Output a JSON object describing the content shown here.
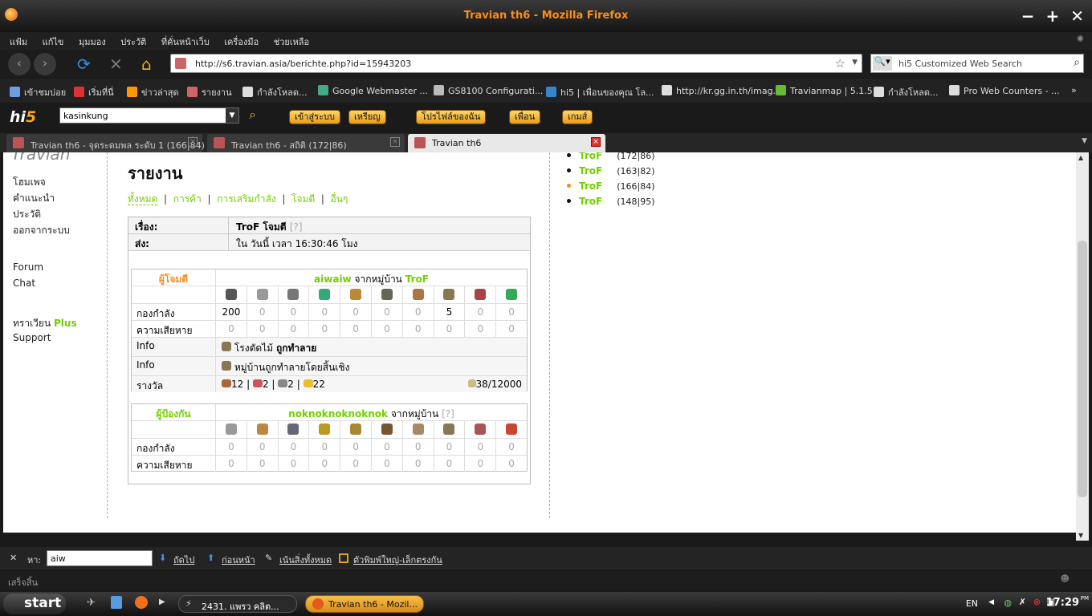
{
  "window": {
    "title": "Travian th6 - Mozilla Firefox"
  },
  "menubar": [
    "แฟ้ม",
    "แก้ไข",
    "มุมมอง",
    "ประวัติ",
    "ที่คั่นหน้าเว็บ",
    "เครื่องมือ",
    "ช่วยเหลือ"
  ],
  "nav": {
    "url": "http://s6.travian.asia/berichte.php?id=15943203",
    "search_placeholder": "hi5 Customized Web Search"
  },
  "bookmarks": [
    "เข้าชมบ่อย",
    "เริ่มที่นี่",
    "ข่าวล่าสุด",
    "รายงาน",
    "กำลังโหลด...",
    "Google Webmaster ...",
    "GS8100 Configurati...",
    "hi5 | เพื่อนของคุณ โล...",
    "http://kr.gg.in.th/imag...",
    "Travianmap | 5.1.5",
    "กำลังโหลด...",
    "Pro Web Counters - ...",
    "»"
  ],
  "hi5bar": {
    "logo_a": "hi",
    "logo_b": "5",
    "search_value": "kasinkung",
    "login": "เข้าสู่ระบบ",
    "coins": "เหรียญ",
    "profile": "โปรไฟล์ของฉัน",
    "friends": "เพื่อน",
    "games": "เกมส์"
  },
  "tabs": [
    {
      "label": "Travian th6 - จุดระดมพล ระดับ 1 (166|84)"
    },
    {
      "label": "Travian th6 - สถิติ (172|86)"
    },
    {
      "label": "Travian th6"
    }
  ],
  "sidebar": {
    "links": [
      "โฮมเพจ",
      "คำแนะนำ",
      "ประวัติ",
      "ออกจากระบบ",
      "Forum",
      "Chat",
      "ทราเวียน",
      "Plus",
      "Support"
    ]
  },
  "report": {
    "heading": "รายงาน",
    "filters": [
      "ทั้งหมด",
      "การค้า",
      "การเสริมกำลัง",
      "โจมตี",
      "อื่นๆ"
    ],
    "subject_label": "เรื่อง:",
    "subject_village": "TroF",
    "subject_action": "โจมตี",
    "subject_help": "[?]",
    "sent_label": "ส่ง:",
    "sent_value": "ใน วันนี้ เวลา 16:30:46 โมง",
    "attacker": {
      "role": "ผู้โจมตี",
      "player": "aiwaiw",
      "from": "จากหมู่บ้าน",
      "village": "TroF",
      "troops_label": "กองกำลัง",
      "troops": [
        "200",
        "0",
        "0",
        "0",
        "0",
        "0",
        "0",
        "5",
        "0",
        "0"
      ],
      "losses_label": "ความเสียหาย",
      "losses": [
        "0",
        "0",
        "0",
        "0",
        "0",
        "0",
        "0",
        "0",
        "0",
        "0"
      ],
      "info_label": "Info",
      "info1_a": "โรงตัดไม้",
      "info1_b": "ถูกทำลาย",
      "info2": "หมู่บ้านถูกทำลายโดยสิ้นเชิง",
      "bounty_label": "รางวัล",
      "bounty": [
        "12",
        "2",
        "2",
        "22"
      ],
      "carry": "38/12000"
    },
    "defender": {
      "role": "ผู้ป้องกัน",
      "player": "noknoknoknoknok",
      "from": "จากหมู่บ้าน",
      "help": "[?]",
      "troops_label": "กองกำลัง",
      "troops": [
        "0",
        "0",
        "0",
        "0",
        "0",
        "0",
        "0",
        "0",
        "0",
        "0"
      ],
      "losses_label": "ความเสียหาย",
      "losses": [
        "0",
        "0",
        "0",
        "0",
        "0",
        "0",
        "0",
        "0",
        "0",
        "0"
      ]
    }
  },
  "villages": [
    {
      "name": "TroF",
      "coord": "(172|86)"
    },
    {
      "name": "TroF",
      "coord": "(163|82)"
    },
    {
      "name": "TroF",
      "coord": "(166|84)"
    },
    {
      "name": "TroF",
      "coord": "(148|95)"
    }
  ],
  "findbar": {
    "label": "หา:",
    "value": "aiw",
    "next": "ถัดไป",
    "prev": "ก่อนหน้า",
    "highlight": "เน้นสิ่งทั้งหมด",
    "match_case": "ตัวพิมพ์ใหญ่-เล็กตรงกัน"
  },
  "status": {
    "text": "เสร็จสิ้น"
  },
  "taskbar": {
    "start": "start",
    "task1": "2431. แพรว คลิต...",
    "task2": "Travian th6 - Mozil...",
    "lang": "EN",
    "time": "17:29",
    "pm": "PM"
  }
}
